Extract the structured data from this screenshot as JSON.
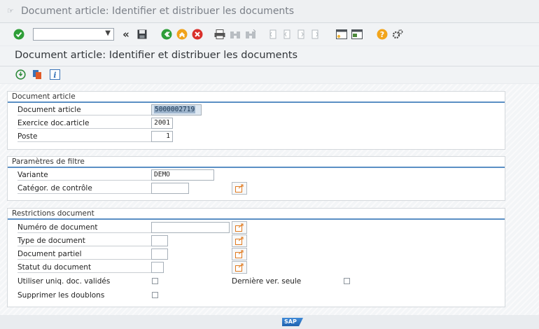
{
  "window": {
    "title": "Document article: Identifier et distribuer les documents"
  },
  "toolbar": {
    "command_value": "",
    "icons": [
      "enter-icon",
      "back-nav-icon",
      "save-icon",
      "back-icon",
      "exit-icon",
      "cancel-icon",
      "print-icon",
      "find-icon",
      "find-next-icon",
      "first-page-icon",
      "previous-page-icon",
      "next-page-icon",
      "last-page-icon",
      "create-session-icon",
      "shortcut-icon",
      "help-icon",
      "customize-layout-icon"
    ]
  },
  "page": {
    "title": "Document article: Identifier et distribuer les documents"
  },
  "app_toolbar": {
    "icons": [
      "execute-icon",
      "get-variant-icon",
      "info-icon"
    ]
  },
  "groups": {
    "document_article": {
      "title": "Document article",
      "doc_label": "Document article",
      "doc_value": "5000002719",
      "year_label": "Exercice doc.article",
      "year_value": "2001",
      "item_label": "Poste",
      "item_value": "1"
    },
    "filter": {
      "title": "Paramètres de filtre",
      "variant_label": "Variante",
      "variant_value": "DEMO",
      "ctrl_label": "Catégor. de contrôle",
      "ctrl_value": ""
    },
    "restrictions": {
      "title": "Restrictions document",
      "docnum_label": "Numéro de document",
      "docnum_value": "",
      "doctype_label": "Type de document",
      "doctype_value": "",
      "docpart_label": "Document partiel",
      "docpart_value": "",
      "status_label": "Statut du document",
      "status_value": "",
      "valid_only_label": "Utiliser uniq. doc. validés",
      "valid_only_checked": false,
      "last_version_label": "Dernière ver. seule",
      "last_version_checked": false,
      "remove_dup_label": "Supprimer les doublons",
      "remove_dup_checked": false
    }
  },
  "status": {
    "logo_text": "SAP"
  },
  "colors": {
    "accent": "#5a8fc4",
    "ok_green": "#2e9e38",
    "exit_orange": "#f0a21a",
    "cancel_red": "#d9302b",
    "help_orange": "#f2a51c"
  }
}
